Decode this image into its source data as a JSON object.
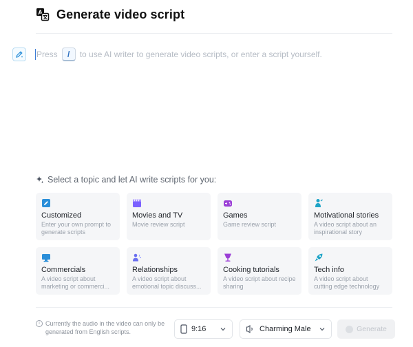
{
  "header": {
    "title": "Generate video script",
    "icon": "ai-translate-icon"
  },
  "editor": {
    "prompt_before": "Press",
    "slash_key": "/",
    "prompt_after": "to use AI writer to generate video scripts, or enter a script yourself."
  },
  "topics": {
    "heading": "Select a topic and let AI write scripts for you:",
    "cards": [
      {
        "name": "Customized",
        "desc": "Enter your own prompt to generate scripts",
        "icon": "edit-icon",
        "color": "#2b8fd9"
      },
      {
        "name": "Movies and TV",
        "desc": "Movie review script",
        "icon": "clapperboard-icon",
        "color": "#7b61ff"
      },
      {
        "name": "Games",
        "desc": "Game review script",
        "icon": "gamepad-icon",
        "color": "#9b3fd6"
      },
      {
        "name": "Motivational stories",
        "desc": "A video script about an inspirational story",
        "icon": "person-icon",
        "color": "#1fa4c7"
      },
      {
        "name": "Commercials",
        "desc": "A video script about marketing or commerci...",
        "icon": "monitor-icon",
        "color": "#2b8fd9"
      },
      {
        "name": "Relationships",
        "desc": "A video script about emotional topic discuss...",
        "icon": "people-icon",
        "color": "#6a6ff0"
      },
      {
        "name": "Cooking tutorials",
        "desc": "A video script about recipe sharing",
        "icon": "cup-icon",
        "color": "#9b3fd6"
      },
      {
        "name": "Tech info",
        "desc": "A video script about cutting edge technology",
        "icon": "rocket-icon",
        "color": "#1fa4c7"
      }
    ]
  },
  "footer": {
    "note": "Currently the audio in the video can only be generated from English scripts.",
    "ratio": "9:16",
    "voice": "Charming Male",
    "generate_label": "Generate"
  }
}
